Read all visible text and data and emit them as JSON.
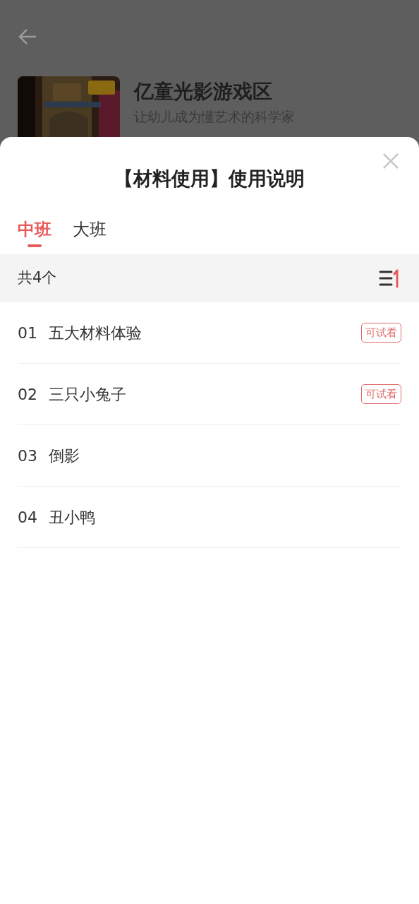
{
  "header": {
    "title": "亿童光影游戏区",
    "subtitle": "让幼儿成为懂艺术的科学家"
  },
  "sheet": {
    "title": "【材料使用】使用说明",
    "tabs": [
      {
        "label": "中班",
        "selected": true
      },
      {
        "label": "大班",
        "selected": false
      }
    ],
    "count": "共4个",
    "items": [
      {
        "number": "01",
        "title": "五大材料体验",
        "badge": "可试看"
      },
      {
        "number": "02",
        "title": "三只小兔子",
        "badge": "可试看"
      },
      {
        "number": "03",
        "title": "倒影"
      },
      {
        "number": "04",
        "title": "丑小鸭"
      }
    ]
  }
}
